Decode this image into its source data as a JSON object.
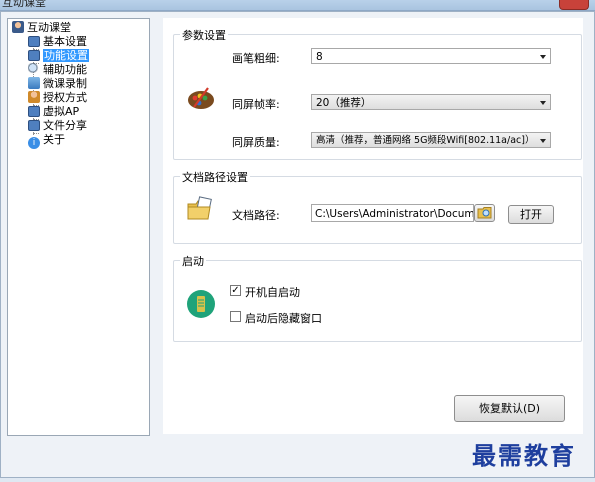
{
  "window": {
    "title": "互动课堂"
  },
  "tree": {
    "root": "互动课堂",
    "items": [
      {
        "label": "基本设置",
        "icon": "monitor-icon"
      },
      {
        "label": "功能设置",
        "icon": "monitor-icon",
        "selected": true
      },
      {
        "label": "辅助功能",
        "icon": "magnifier-icon"
      },
      {
        "label": "微课录制",
        "icon": "screen-record-icon"
      },
      {
        "label": "授权方式",
        "icon": "person-icon"
      },
      {
        "label": "虚拟AP",
        "icon": "monitor-icon"
      },
      {
        "label": "文件分享",
        "icon": "monitor-icon"
      },
      {
        "label": "关于",
        "icon": "info-icon"
      }
    ]
  },
  "params": {
    "title": "参数设置",
    "pen_label": "画笔粗细:",
    "pen_value": "8",
    "fps_label": "同屏帧率:",
    "fps_value": "20（推荐）",
    "quality_label": "同屏质量:",
    "quality_value": "高清（推荐，普通网络 5G频段Wifi[802.11a/ac]）"
  },
  "docpath": {
    "title": "文档路径设置",
    "label": "文档路径:",
    "value": "C:\\Users\\Administrator\\Documents\\互",
    "open_button": "打开"
  },
  "startup": {
    "title": "启动",
    "autostart_label": "开机自启动",
    "autostart_checked": true,
    "hide_label": "启动后隐藏窗口",
    "hide_checked": false
  },
  "restore_button": "恢复默认(D)",
  "watermark": "最需教育"
}
